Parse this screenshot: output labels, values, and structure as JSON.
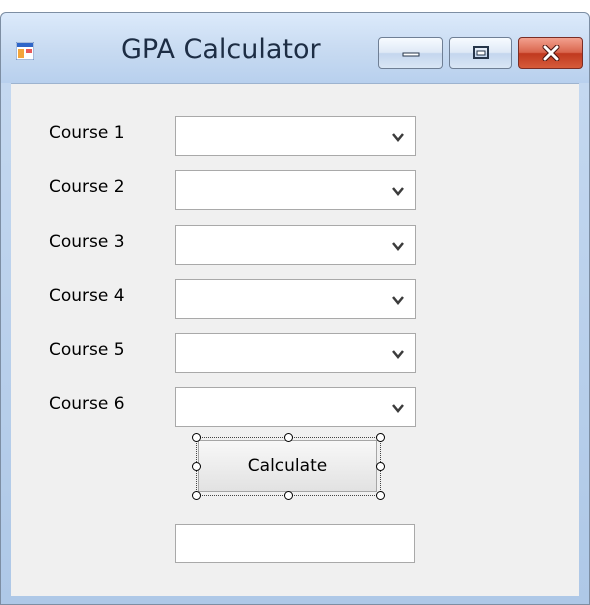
{
  "window": {
    "title": "GPA Calculator",
    "app_icon": "windows-form-icon",
    "controls": {
      "minimize_icon": "minimize-icon",
      "maximize_icon": "maximize-icon",
      "close_icon": "close-icon",
      "close_color": "#c7402a"
    }
  },
  "form": {
    "courses": [
      {
        "label": "Course 1",
        "value": ""
      },
      {
        "label": "Course 2",
        "value": ""
      },
      {
        "label": "Course 3",
        "value": ""
      },
      {
        "label": "Course 4",
        "value": ""
      },
      {
        "label": "Course 5",
        "value": ""
      },
      {
        "label": "Course 6",
        "value": ""
      }
    ],
    "dropdown_icon": "chevron-down-icon",
    "calculate_label": "Calculate",
    "result_value": "",
    "designer_selection": "calculate-button"
  },
  "colors": {
    "titlebar": "#c7daf1",
    "client_background": "#f0f0f0"
  }
}
